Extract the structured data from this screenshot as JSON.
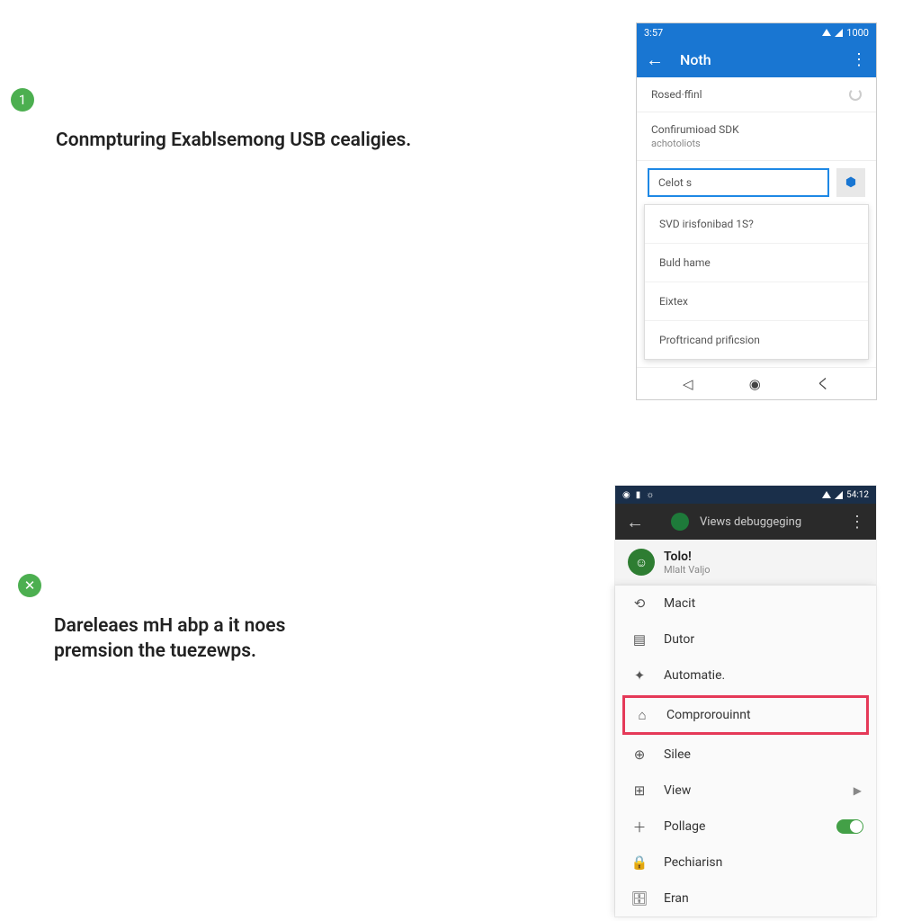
{
  "step1": {
    "badge": "1",
    "text": "Conmpturing Exablsemong USB cealigies."
  },
  "step2": {
    "badge": "✕",
    "text": "Dareleaes mH abp a it noes premsion the tuezewps."
  },
  "phone1": {
    "status_time": "3:57",
    "status_batt": "1000",
    "appbar_title": "Noth",
    "row_rosed": "Rosed·ffinl",
    "row_confir": "Confirumioad SDK",
    "row_confir_sub": "achotoliots",
    "dropdown_value": "Celot s",
    "options": [
      "SVD irisfonibad 1S?",
      "Buld hame",
      "Eixtex",
      "Proftricand prificsion"
    ]
  },
  "phone2": {
    "status_time": "54:12",
    "appbar_title": "Views debuggeging",
    "header_name": "Tolo!",
    "header_sub": "Mlalt Valjo",
    "menu": {
      "m1": "Macit",
      "m2": "Dutor",
      "m3": "Automatie.",
      "m4": "Comprorouinnt",
      "m5": "Silee",
      "m6": "View",
      "m7": "Pollage",
      "m8": "Pechiarisn",
      "m9": "Eran"
    }
  }
}
